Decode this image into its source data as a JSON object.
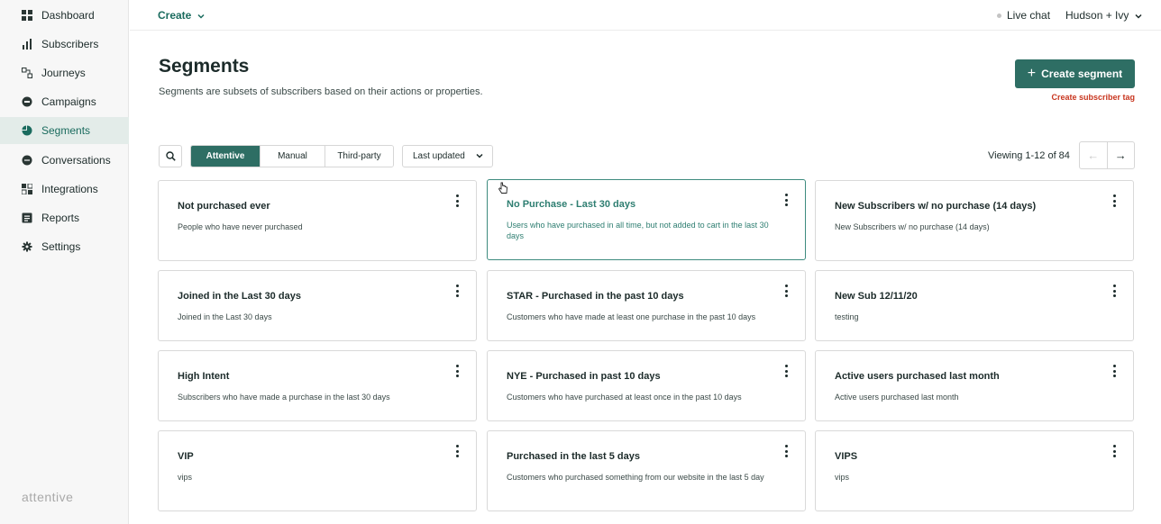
{
  "sidebar": {
    "items": [
      {
        "label": "Dashboard",
        "icon": "dashboard-icon"
      },
      {
        "label": "Subscribers",
        "icon": "bar-chart-icon"
      },
      {
        "label": "Journeys",
        "icon": "journeys-icon"
      },
      {
        "label": "Campaigns",
        "icon": "campaigns-icon"
      },
      {
        "label": "Segments",
        "icon": "pie-icon",
        "active": true
      },
      {
        "label": "Conversations",
        "icon": "chat-icon"
      },
      {
        "label": "Integrations",
        "icon": "integrations-icon"
      },
      {
        "label": "Reports",
        "icon": "reports-icon"
      },
      {
        "label": "Settings",
        "icon": "gear-icon"
      }
    ],
    "brand": "attentive"
  },
  "topbar": {
    "create_label": "Create",
    "livechat_label": "Live chat",
    "account_label": "Hudson + Ivy"
  },
  "header": {
    "title": "Segments",
    "description": "Segments are subsets of subscribers based on their actions or properties.",
    "create_button": "Create segment",
    "create_tag_link": "Create subscriber tag"
  },
  "toolbar": {
    "tabs": [
      "Attentive",
      "Manual",
      "Third-party"
    ],
    "active_tab": "Attentive",
    "sort_label": "Last updated",
    "viewing_text": "Viewing 1-12 of 84"
  },
  "cards": [
    {
      "title": "Not purchased ever",
      "description": "People who have never purchased"
    },
    {
      "title": "No Purchase - Last 30 days",
      "description": "Users who have purchased in all time, but not added to cart in the last 30 days",
      "highlighted": true
    },
    {
      "title": "New Subscribers w/ no purchase (14 days)",
      "description": "New Subscribers w/ no purchase (14 days)"
    },
    {
      "title": "Joined in the Last 30 days",
      "description": "Joined in the Last 30 days"
    },
    {
      "title": "STAR - Purchased in the past 10 days",
      "description": "Customers who have made at least one purchase in the past 10 days"
    },
    {
      "title": "New Sub 12/11/20",
      "description": "testing"
    },
    {
      "title": "High Intent",
      "description": "Subscribers who have made a purchase in the last 30 days"
    },
    {
      "title": "NYE - Purchased in past 10 days",
      "description": "Customers who have purchased at least once in the past 10 days"
    },
    {
      "title": "Active users purchased last month",
      "description": "Active users purchased last month"
    },
    {
      "title": "VIP",
      "description": "vips"
    },
    {
      "title": "Purchased in the last 5 days",
      "description": "Customers who purchased something from our website in the last 5 day"
    },
    {
      "title": "VIPS",
      "description": "vips"
    }
  ],
  "colors": {
    "accent": "#2e6e64",
    "link_red": "#c8351e",
    "active_nav_bg": "#e3ece9"
  }
}
